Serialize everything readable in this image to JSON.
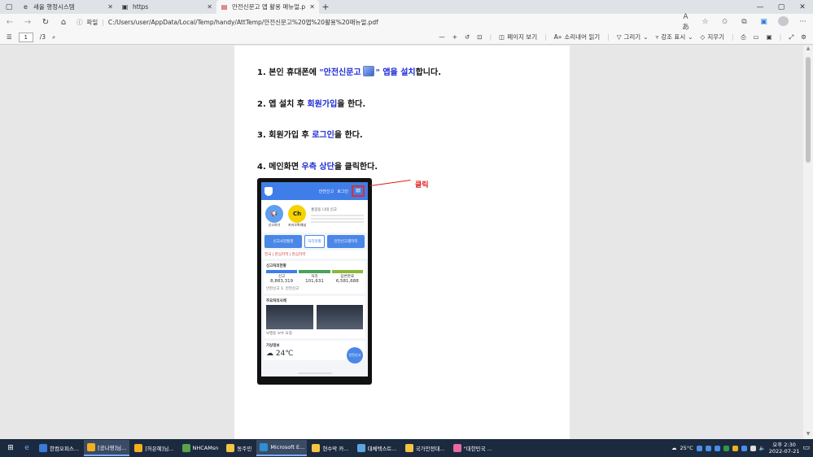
{
  "browser": {
    "tabs": [
      {
        "title": "새올 행정시스템",
        "active": false
      },
      {
        "title": "https",
        "active": false
      },
      {
        "title": "안전신문고 앱 활용 매뉴얼.pdf",
        "active": true
      }
    ],
    "new_tab": "+",
    "window_controls": [
      "—",
      "▢",
      "✕"
    ],
    "address": {
      "security_label": "파일",
      "url": "C:/Users/user/AppData/Local/Temp/handy/AttTemp/안전신문고%20앱%20활용%20매뉴얼.pdf"
    }
  },
  "pdf_toolbar": {
    "page_current": "1",
    "page_total": "/3",
    "zoom_minus": "—",
    "zoom_plus": "+",
    "page_view_label": "페이지 보기",
    "read_aloud_label": "소리내어 읽기",
    "draw_label": "그리기",
    "highlight_label": "강조 표시",
    "erase_label": "지우기"
  },
  "document": {
    "steps": [
      {
        "prefix": "1. 본인  휴대폰에  ",
        "highlight": "\"안전신문고",
        "highlight2": "\" 앱을 설치",
        "suffix": "합니다."
      },
      {
        "prefix": "2. 앱 설치 후 ",
        "highlight": "회원가입",
        "suffix": "을 한다."
      },
      {
        "prefix": "3. 회원가입 후 ",
        "highlight": "로그인",
        "suffix": "을 한다."
      },
      {
        "prefix": "4. 메인화면 ",
        "highlight": "우측 상단",
        "suffix": "을 클릭한다."
      }
    ],
    "callout": "클릭",
    "phone": {
      "header_items": [
        "안전신고",
        "로그인"
      ],
      "btn_report": "신고하기",
      "btn_kakao": "카카오톡채널",
      "circle_blue": "📢",
      "circle_yellow": "Ch",
      "user_line": "홍길동 나의 신고",
      "buttons": [
        "신고사진촬영",
        "처리현황",
        "안전신고갤러리"
      ],
      "tabs": "전국 | 관심지역 | 관심지역",
      "card1_title": "신고처리현황",
      "stats": [
        {
          "label": "신고",
          "value": "8,883,319"
        },
        {
          "label": "처리",
          "value": "101,631"
        },
        {
          "label": "답변완료",
          "value": "6,581,688"
        }
      ],
      "region": "안전신고 1. 안전신고",
      "card2_title": "주요처리사례",
      "case_caption": "보행등 보수 요청",
      "card3_title": "기상정보",
      "temp": "24℃",
      "fab": "안전신고"
    }
  },
  "taskbar": {
    "apps": [
      {
        "label": "한컴오피스...",
        "color": "#3a7bd5",
        "active": false
      },
      {
        "label": "[공나영]님...",
        "color": "#f2b01e",
        "active": true
      },
      {
        "label": "[허은혜]님...",
        "color": "#f2b01e",
        "active": false
      },
      {
        "label": "NHCAMsn",
        "color": "#59a34a",
        "active": false
      },
      {
        "label": "동주민",
        "color": "#f4c542",
        "active": false
      },
      {
        "label": "Microsoft E...",
        "color": "#2d8fd5",
        "active": true
      },
      {
        "label": "현수막 카...",
        "color": "#f4c542",
        "active": false
      },
      {
        "label": "대체텍스트...",
        "color": "#5aa7e0",
        "active": false
      },
      {
        "label": "국가안전대...",
        "color": "#f4c542",
        "active": false
      },
      {
        "label": "\"대한민국 ...",
        "color": "#e86aa0",
        "active": false
      }
    ],
    "weather": "25°C",
    "clock_time": "오후 2:30",
    "clock_date": "2022-07-21"
  }
}
